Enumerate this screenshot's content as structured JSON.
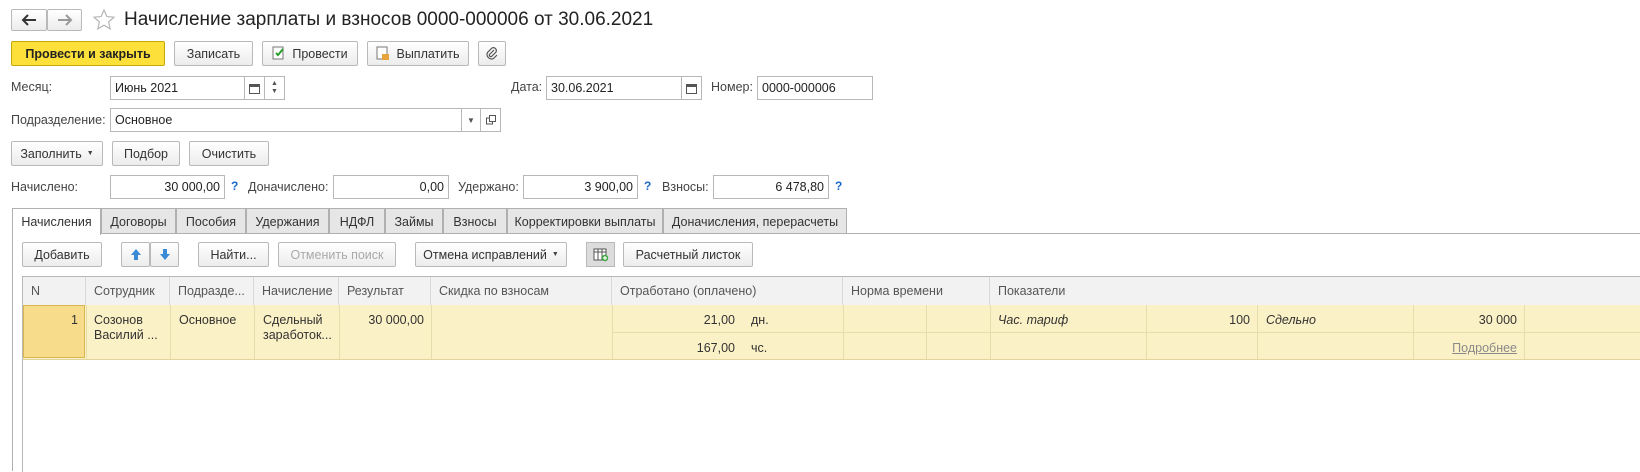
{
  "title": "Начисление зарплаты и взносов 0000-000006 от 30.06.2021",
  "toolbar": {
    "post_close": "Провести и закрыть",
    "write": "Записать",
    "post": "Провести",
    "pay": "Выплатить"
  },
  "form": {
    "month_label": "Месяц:",
    "month_value": "Июнь 2021",
    "date_label": "Дата:",
    "date_value": "30.06.2021",
    "number_label": "Номер:",
    "number_value": "0000-000006",
    "division_label": "Подразделение:",
    "division_value": "Основное"
  },
  "actions": {
    "fill": "Заполнить",
    "select": "Подбор",
    "clear": "Очистить"
  },
  "totals": {
    "accrued_label": "Начислено:",
    "accrued_value": "30 000,00",
    "additional_label": "Доначислено:",
    "additional_value": "0,00",
    "withheld_label": "Удержано:",
    "withheld_value": "3 900,00",
    "contributions_label": "Взносы:",
    "contributions_value": "6 478,80",
    "help": "?"
  },
  "tabs": [
    "Начисления",
    "Договоры",
    "Пособия",
    "Удержания",
    "НДФЛ",
    "Займы",
    "Взносы",
    "Корректировки выплаты",
    "Доначисления, перерасчеты"
  ],
  "grid_toolbar": {
    "add": "Добавить",
    "find": "Найти...",
    "cancel_search": "Отменить поиск",
    "correction": "Отмена исправлений",
    "payslip": "Расчетный листок"
  },
  "columns": [
    "N",
    "Сотрудник",
    "Подразде...",
    "Начисление",
    "Результат",
    "Скидка по взносам",
    "Отработано (оплачено)",
    "Норма времени",
    "Показатели"
  ],
  "row": {
    "n": "1",
    "employee_line1": "Созонов",
    "employee_line2": "Василий ...",
    "division": "Основное",
    "accrual_line1": "Сдельный",
    "accrual_line2": "заработок...",
    "result": "30 000,00",
    "worked_days": "21,00",
    "days_unit": "дн.",
    "worked_hours": "167,00",
    "hours_unit": "чс.",
    "indicator1_name": "Час. тариф",
    "indicator1_value": "100",
    "indicator2_name": "Сдельно",
    "indicator2_value": "30 000",
    "details_link": "Подробнее"
  },
  "colors": {
    "primary_button": "#fde13a",
    "row_highlight": "#fbf1c6",
    "selected_cell": "#f7dc8c",
    "help_blue": "#1b6ac9"
  }
}
